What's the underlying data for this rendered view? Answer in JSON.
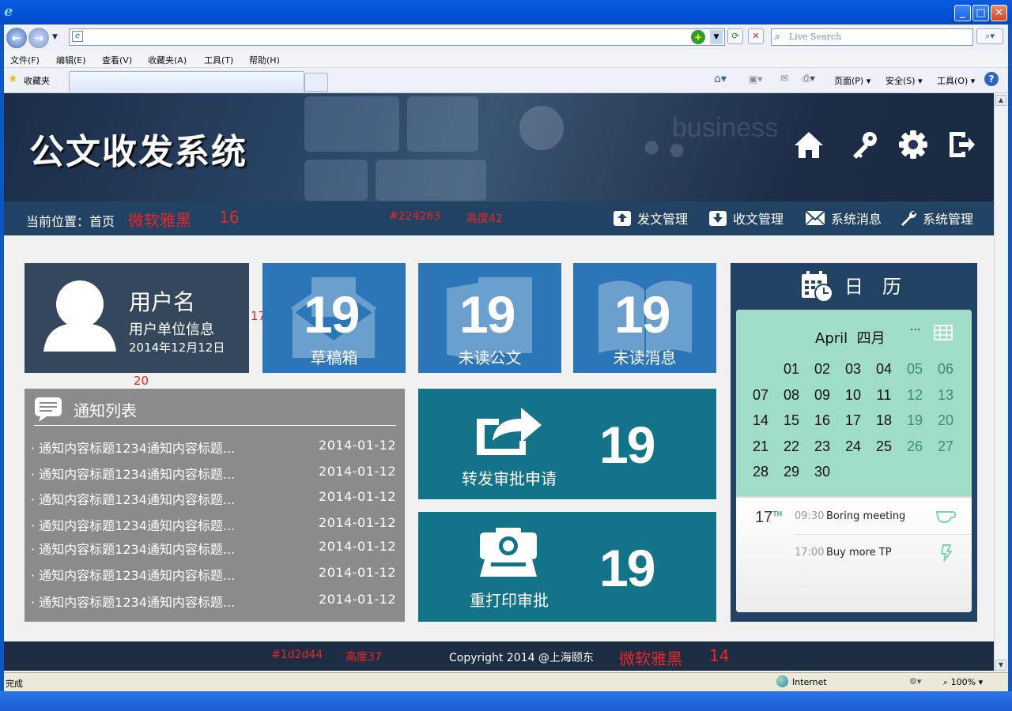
{
  "browser": {
    "menu": [
      "文件(F)",
      "编辑(E)",
      "查看(V)",
      "收藏夹(A)",
      "工具(T)",
      "帮助(H)"
    ],
    "search_placeholder": "Live Search",
    "favorites_label": "收藏夹",
    "cmd": {
      "page": "页面(P)",
      "safety": "安全(S)",
      "tools": "工具(O)"
    },
    "status_left": "完成",
    "status_zone": "Internet",
    "zoom": "100%"
  },
  "header": {
    "brand": "公文收发系统",
    "icons": [
      "home-icon",
      "key-icon",
      "gear-icon",
      "logout-icon"
    ]
  },
  "crumb": {
    "text": "当前位置：首页",
    "anno_font": "微软雅黑",
    "anno_size": "16",
    "anno_color": "#224263",
    "anno_height": "高度42"
  },
  "topnav": [
    {
      "label": "发文管理",
      "icon": "upload-icon"
    },
    {
      "label": "收文管理",
      "icon": "download-icon"
    },
    {
      "label": "系统消息",
      "icon": "mail-icon"
    },
    {
      "label": "系统管理",
      "icon": "wrench-icon"
    }
  ],
  "user": {
    "name": "用户名",
    "unit": "用户单位信息",
    "date": "2014年12月12日",
    "anno_gap_h": "17",
    "anno_gap_v": "20"
  },
  "tiles": {
    "drafts": {
      "count": "19",
      "label": "草稿箱"
    },
    "unread_docs": {
      "count": "19",
      "label": "未读公文"
    },
    "unread_msgs": {
      "count": "19",
      "label": "未读消息"
    },
    "forward": {
      "count": "19",
      "label": "转发审批申请"
    },
    "reprint": {
      "count": "19",
      "label": "重打印审批"
    }
  },
  "notice": {
    "title": "通知列表",
    "rows": [
      {
        "title": "· 通知内容标题1234通知内容标题...",
        "date": "2014-01-12"
      },
      {
        "title": "· 通知内容标题1234通知内容标题...",
        "date": "2014-01-12"
      },
      {
        "title": "· 通知内容标题1234通知内容标题...",
        "date": "2014-01-12"
      },
      {
        "title": "· 通知内容标题1234通知内容标题...",
        "date": "2014-01-12"
      },
      {
        "title": "· 通知内容标题1234通知内容标题...",
        "date": "2014-01-12"
      },
      {
        "title": "· 通知内容标题1234通知内容标题...",
        "date": "2014-01-12"
      },
      {
        "title": "· 通知内容标题1234通知内容标题...",
        "date": "2014-01-12"
      }
    ]
  },
  "calendar": {
    "title": "日　历",
    "month": "April  四月",
    "more": "···",
    "weeks": [
      [
        "",
        "",
        "01",
        "02",
        "03",
        "04",
        "05",
        "06"
      ],
      [
        "07",
        "08",
        "09",
        "10",
        "11",
        "12",
        "13"
      ],
      [
        "14",
        "15",
        "16",
        "17",
        "18",
        "19",
        "20"
      ],
      [
        "21",
        "22",
        "23",
        "24",
        "25",
        "26",
        "27"
      ],
      [
        "28",
        "29",
        "30"
      ]
    ],
    "event_day": "17",
    "event_suffix": "TH",
    "events": [
      {
        "time": "09:30",
        "title": "Boring meeting",
        "icon": "cup-icon"
      },
      {
        "time": "17:00",
        "title": "Buy more TP",
        "icon": "bolt-icon"
      }
    ]
  },
  "footer": {
    "anno_color": "#1d2d44",
    "anno_height": "高度37",
    "copyright": "Copyright 2014 @上海颐东",
    "anno_font": "微软雅黑",
    "anno_size": "14"
  },
  "colors": {
    "header_dark": "#1b2c47",
    "crumb_bar": "#224263",
    "footer": "#1d2d44",
    "tile_blue": "#2b75b8",
    "tile_teal": "#137389",
    "user_panel": "#35475c",
    "notice_gray": "#8a8a8f",
    "calendar_green": "#9fddc8",
    "annotation_red": "#e82727"
  }
}
